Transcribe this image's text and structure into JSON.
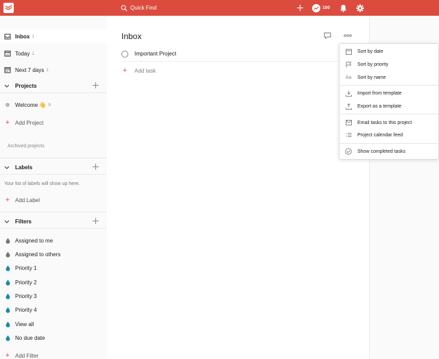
{
  "topbar": {
    "search_placeholder": "Quick Find",
    "karma": "100"
  },
  "sidebar": {
    "inbox": {
      "label": "Inbox",
      "count": "1"
    },
    "today": {
      "label": "Today",
      "count": "1"
    },
    "next7": {
      "label": "Next 7 days",
      "count": "1"
    },
    "projects": {
      "title": "Projects",
      "items": [
        {
          "label": "Welcome 👋",
          "count": "9"
        }
      ],
      "add_label": "Add Project",
      "archived": "Archived projects"
    },
    "labels": {
      "title": "Labels",
      "empty_text": "Your list of labels will show up here.",
      "add_label": "Add Label"
    },
    "filters": {
      "title": "Filters",
      "items": [
        "Assigned to me",
        "Assigned to others",
        "Priority 1",
        "Priority 2",
        "Priority 3",
        "Priority 4",
        "View all",
        "No due date"
      ],
      "add_label": "Add Filter"
    }
  },
  "main": {
    "title": "Inbox",
    "tasks": [
      {
        "text": "Important Project"
      }
    ],
    "add_task": "Add task"
  },
  "menu": {
    "items": [
      {
        "label": "Sort by date",
        "icon": "calendar-icon"
      },
      {
        "label": "Sort by priority",
        "icon": "flag-icon"
      },
      {
        "label": "Sort by name",
        "icon": "text-icon"
      },
      {
        "label": "Import from template",
        "icon": "download-icon"
      },
      {
        "label": "Export as a template",
        "icon": "upload-icon"
      },
      {
        "label": "Email tasks to this project",
        "icon": "mail-icon"
      },
      {
        "label": "Project calendar feed",
        "icon": "list-icon"
      },
      {
        "label": "Show completed tasks",
        "icon": "check-circle-icon"
      }
    ]
  },
  "colors": {
    "brand": "#db4c3f",
    "filter_dark": "#808080",
    "filter_blue": "#246fe0",
    "filter_teal": "#1a8aa8"
  }
}
